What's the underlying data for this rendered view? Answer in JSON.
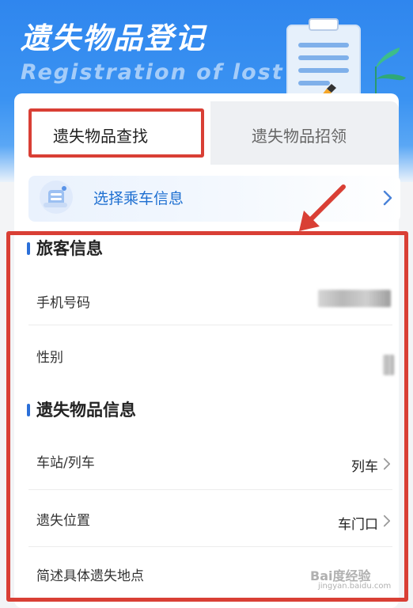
{
  "header": {
    "title": "遗失物品登记",
    "subtitle": "Registration of lost"
  },
  "tabs": [
    {
      "label": "遗失物品查找",
      "active": true
    },
    {
      "label": "遗失物品招领",
      "active": false
    }
  ],
  "select_trip": {
    "label": "选择乘车信息",
    "icon": "ticket-icon"
  },
  "passenger_section": {
    "title": "旅客信息",
    "rows": [
      {
        "label": "手机号码",
        "value_redacted": true
      },
      {
        "label": "性别",
        "value_redacted": true
      }
    ]
  },
  "item_section": {
    "title": "遗失物品信息",
    "rows": [
      {
        "label": "车站/列车",
        "value": "列车"
      },
      {
        "label": "遗失位置",
        "value": "车门口"
      },
      {
        "label": "简述具体遗失地点",
        "value": ""
      }
    ]
  },
  "watermark": {
    "text": "Bai度经验",
    "url_text": "jingyan.baidu.com"
  },
  "colors": {
    "hero_blue": "#2f86ee",
    "accent_blue": "#1e6fd1",
    "annotation_red": "#d93f35"
  }
}
